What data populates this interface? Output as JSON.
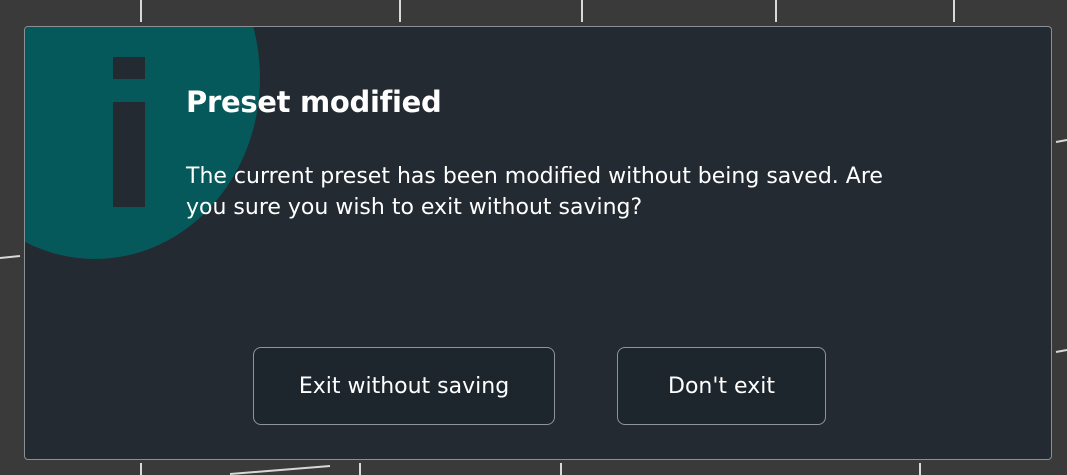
{
  "dialog": {
    "icon": "info-icon",
    "title": "Preset modified",
    "message": "The current preset has been modified without being saved. Are you sure you wish to exit without saving?",
    "buttons": {
      "exit_label": "Exit without saving",
      "stay_label": "Don't exit"
    }
  },
  "colors": {
    "dialog_background": "#232a31",
    "info_circle": "#05595a",
    "button_background": "#1d262d",
    "button_border": "#8e959a",
    "text": "#ffffff"
  }
}
